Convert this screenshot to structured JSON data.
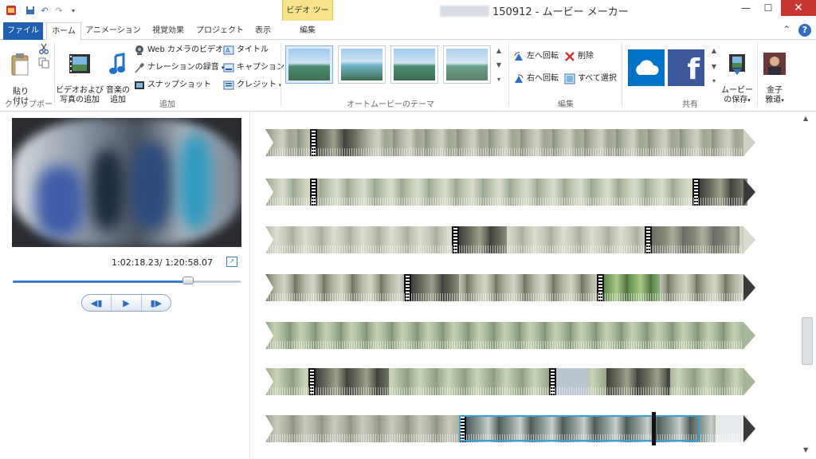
{
  "window": {
    "title": "150912 - ムービー メーカー",
    "context_header": "ビデオ ツール"
  },
  "quick_access": {
    "icons": [
      "app-icon",
      "save-icon",
      "undo-icon",
      "redo-icon",
      "customize-icon"
    ]
  },
  "tabs": {
    "file": "ファイル",
    "home": "ホーム",
    "animation": "アニメーション",
    "visual_effects": "視覚効果",
    "project": "プロジェクト",
    "view": "表示",
    "edit": "編集"
  },
  "ribbon": {
    "clipboard": {
      "paste": "貼り\n付け",
      "group_label": "クリップボード"
    },
    "add": {
      "add_video_photo": "ビデオおよび\n写真の追加",
      "add_music": "音楽の\n追加",
      "webcam_video": "Web カメラのビデオ",
      "record_narration": "ナレーションの録音",
      "snapshot": "スナップショット",
      "title": "タイトル",
      "caption": "キャプション",
      "credits": "クレジット",
      "group_label": "追加"
    },
    "themes": {
      "group_label": "オートムービーのテーマ",
      "count": 4,
      "selected_index": 0
    },
    "edit": {
      "rotate_left": "左へ回転",
      "rotate_right": "右へ回転",
      "delete": "削除",
      "select_all": "すべて選択",
      "group_label": "編集"
    },
    "share": {
      "save_movie": "ムービー\nの保存",
      "group_label": "共有"
    },
    "account": {
      "name": "金子\n雅道"
    }
  },
  "preview": {
    "timecode": "1:02:18.23/ 1:20:58.07",
    "progress": 0.769
  },
  "colors": {
    "accent": "#1e5fb4",
    "context_tab": "#f7e48a",
    "selection": "#36a0de",
    "close_button": "#c7372f"
  }
}
